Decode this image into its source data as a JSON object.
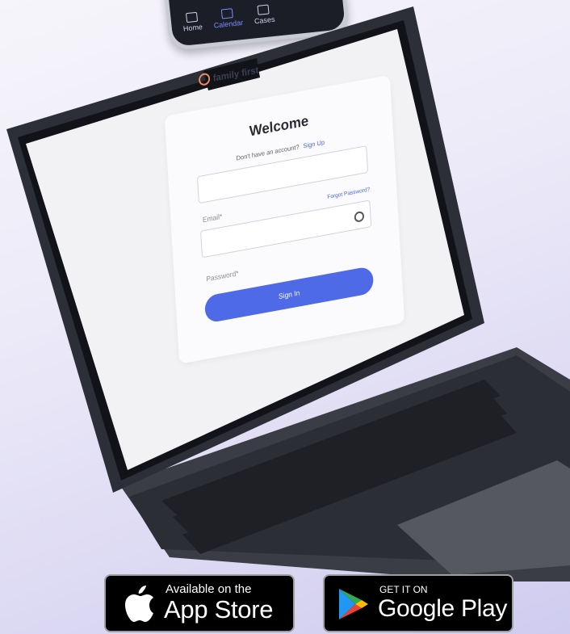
{
  "phone": {
    "tabs": [
      {
        "label": "Home",
        "icon": "home-icon"
      },
      {
        "label": "Calendar",
        "icon": "calendar-icon"
      },
      {
        "label": "Cases",
        "icon": "cases-icon"
      }
    ]
  },
  "login": {
    "brand": "family first",
    "title": "Welcome",
    "no_account": "Don't have an account?",
    "signup": "Sign Up",
    "email_label": "Email*",
    "forgot": "Forgot Password?",
    "password_label": "Password*",
    "signin": "Sign In"
  },
  "badges": {
    "appstore_small": "Available on the",
    "appstore_big": "App Store",
    "gplay_small": "GET IT ON",
    "gplay_big": "Google Play"
  },
  "colors": {
    "accent": "#4f6ae6",
    "brand": "#f18a63"
  }
}
